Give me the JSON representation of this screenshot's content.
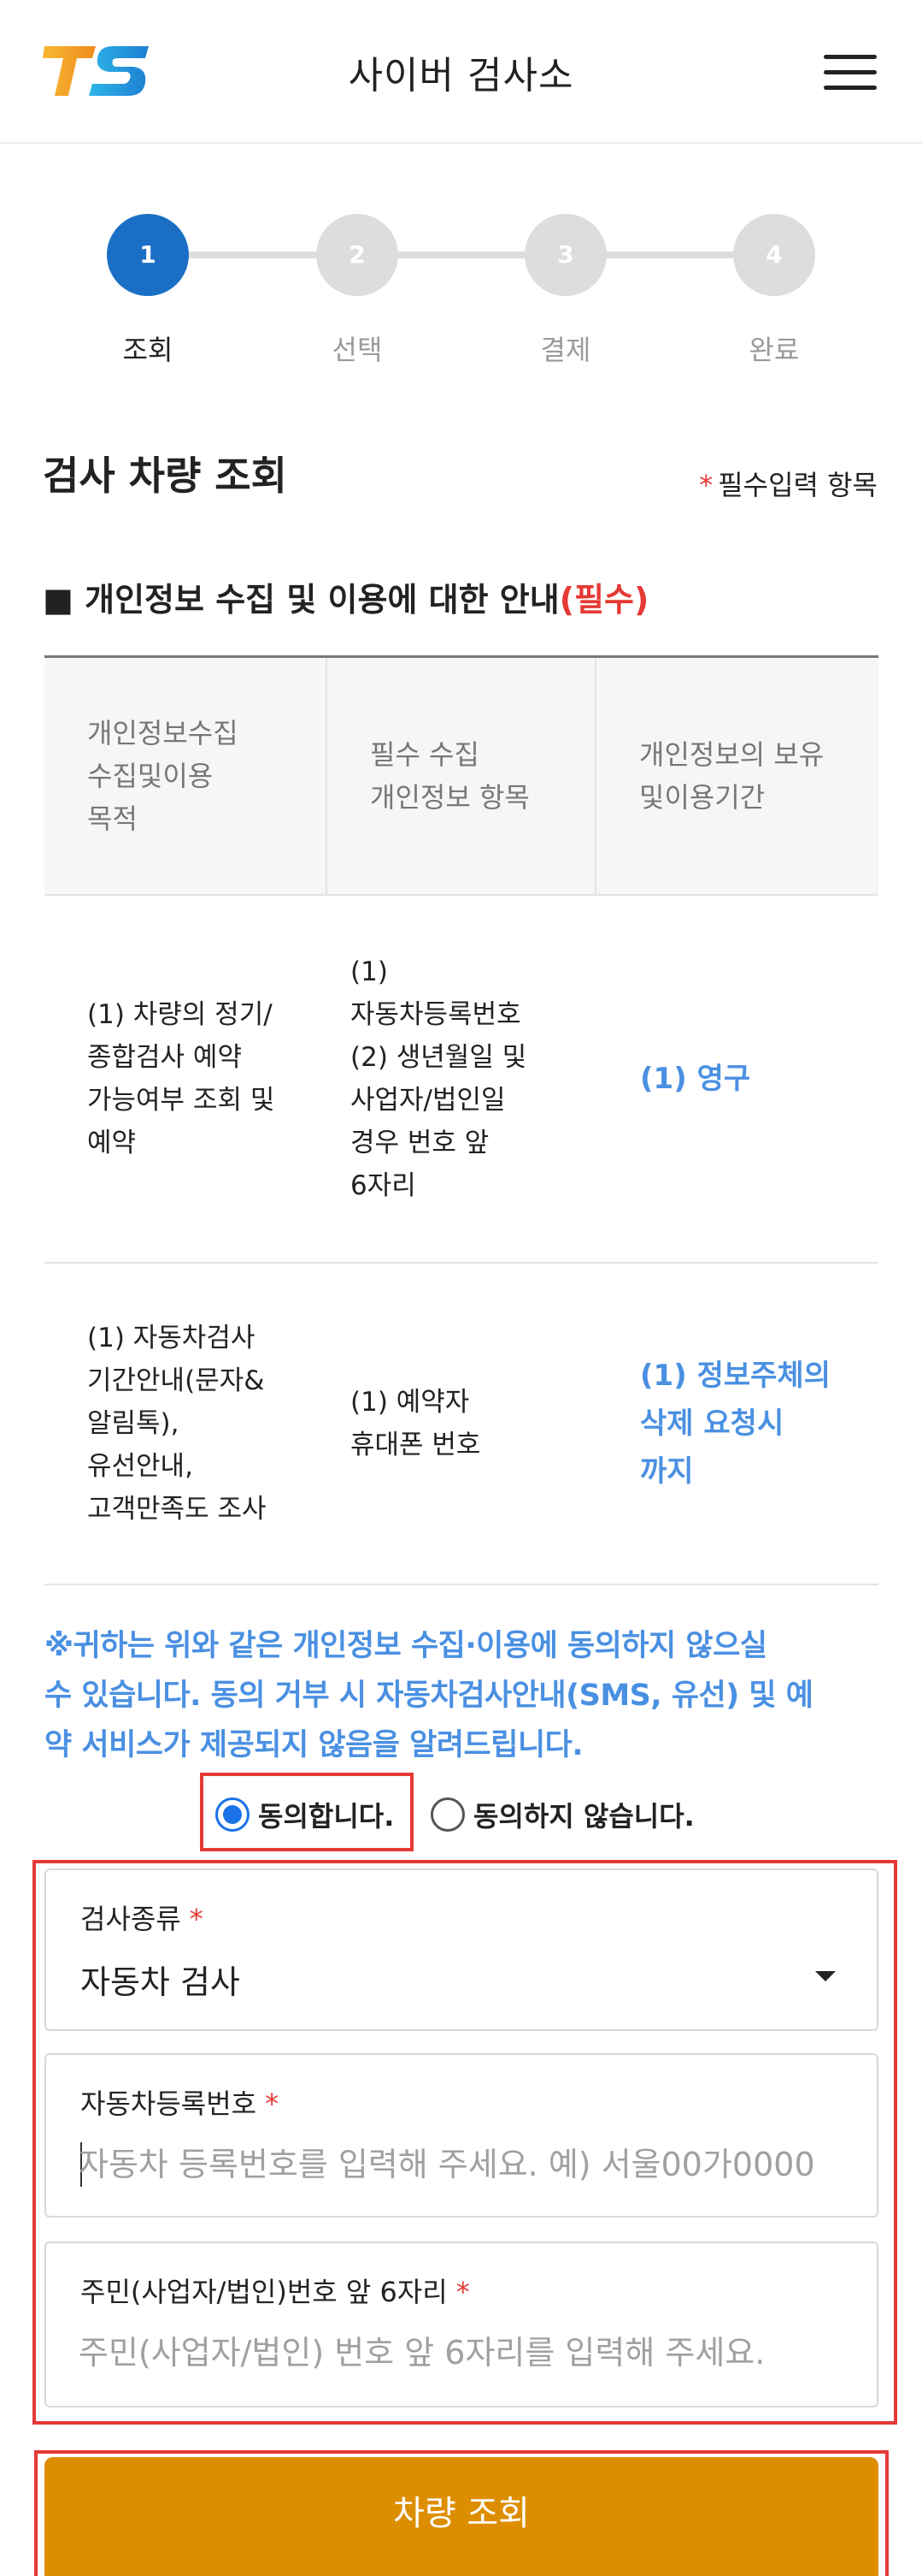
{
  "header": {
    "title": "사이버 검사소",
    "logo_text": "TS",
    "logo_colors": {
      "t": "#f5a623",
      "s": "#29a3e0"
    }
  },
  "stepper": {
    "steps": [
      {
        "number": "1",
        "label": "조회",
        "active": true
      },
      {
        "number": "2",
        "label": "선택",
        "active": false
      },
      {
        "number": "3",
        "label": "결제",
        "active": false
      },
      {
        "number": "4",
        "label": "완료",
        "active": false
      }
    ]
  },
  "section": {
    "title": "검사 차량 조회",
    "required_note_star": "*",
    "required_note": "필수입력 항목"
  },
  "privacy": {
    "heading_prefix": "■ 개인정보 수집 및 이용에 대한 안내",
    "heading_required": "(필수)",
    "table": {
      "headers": [
        [
          "개인정보수집",
          "수집및이용",
          "목적"
        ],
        [
          "필수 수집",
          "개인정보 항목"
        ],
        [
          "개인정보의 보유",
          "및이용기간"
        ]
      ],
      "rows": [
        {
          "purpose": [
            "(1) 차량의 정기/",
            "종합검사 예약",
            "가능여부 조회 및",
            "예약"
          ],
          "items": [
            "(1)",
            "자동차등록번호",
            "(2) 생년월일 및",
            "사업자/법인일",
            "경우 번호 앞",
            "6자리"
          ],
          "period": [
            "(1) 영구"
          ]
        },
        {
          "purpose": [
            "(1) 자동차검사",
            "기간안내(문자&",
            "알림톡),",
            "유선안내,",
            "고객만족도 조사"
          ],
          "items": [
            "(1) 예약자",
            "휴대폰 번호"
          ],
          "period": [
            "(1) 정보주체의",
            "삭제 요청시",
            "까지"
          ]
        }
      ]
    },
    "notice_lines": [
      "※귀하는 위와 같은 개인정보 수집·이용에 동의하지 않으실",
      "수 있습니다. 동의 거부 시 자동차검사안내(SMS, 유선) 및 예",
      "약 서비스가 제공되지 않음을 알려드립니다."
    ],
    "consent": {
      "agree_label": "동의합니다.",
      "disagree_label": "동의하지 않습니다.",
      "selected": "agree"
    }
  },
  "form": {
    "inspection_type": {
      "label": "검사종류",
      "star": "*",
      "value": "자동차 검사"
    },
    "car_number": {
      "label": "자동차등록번호",
      "star": "*",
      "placeholder": "자동차 등록번호를 입력해 주세요. 예) 서울00가0000"
    },
    "id_number": {
      "label": "주민(사업자/법인)번호 앞 6자리",
      "star": "*",
      "placeholder": "주민(사업자/법인) 번호 앞 6자리를 입력해 주세요."
    }
  },
  "submit": {
    "label": "차량 조회"
  },
  "colors": {
    "accent_blue": "#1a6fc4",
    "link_blue": "#4a90e2",
    "required_red": "#e53935",
    "button_orange": "#dd8e00"
  }
}
